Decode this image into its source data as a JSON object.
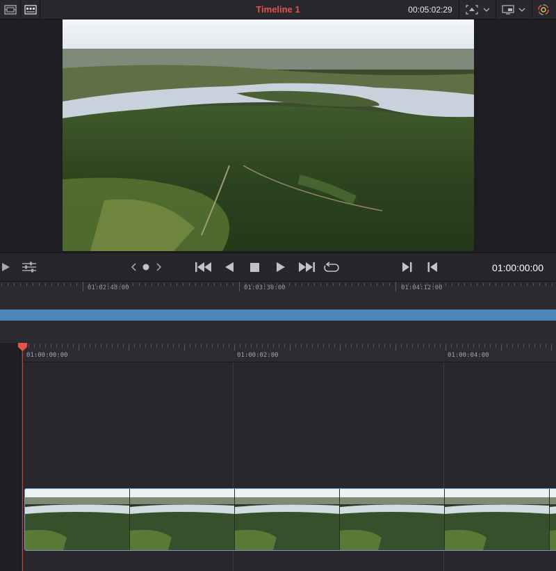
{
  "topbar": {
    "title": "Timeline 1",
    "timecode": "00:05:02:29",
    "left_icons": [
      "viewer-layout-icon",
      "clip-view-icon"
    ],
    "right_icons": [
      "transform-icon",
      "display-mode-icon",
      "color-scope-icon"
    ]
  },
  "transport": {
    "timecode": "01:00:00:00",
    "icons": [
      "play-left-icon",
      "sliders-icon",
      "prev-marker-icon",
      "marker-dot-icon",
      "next-marker-icon",
      "skip-to-start-icon",
      "play-reverse-icon",
      "stop-icon",
      "play-icon",
      "skip-to-end-icon",
      "loop-icon",
      "mark-in-icon",
      "mark-out-icon"
    ]
  },
  "overview_ruler": {
    "labels": [
      "01:02:48:00",
      "01:03:30:00",
      "01:04:12:00"
    ]
  },
  "timeline_ruler": {
    "labels": [
      "01:00:00:00",
      "01:00:02:00",
      "01:00:04:00"
    ]
  },
  "colors": {
    "title": "#e5534b",
    "playhead": "#d0453d",
    "overview_bar": "#4f87b8",
    "clip_border": "#6aa0cf"
  }
}
